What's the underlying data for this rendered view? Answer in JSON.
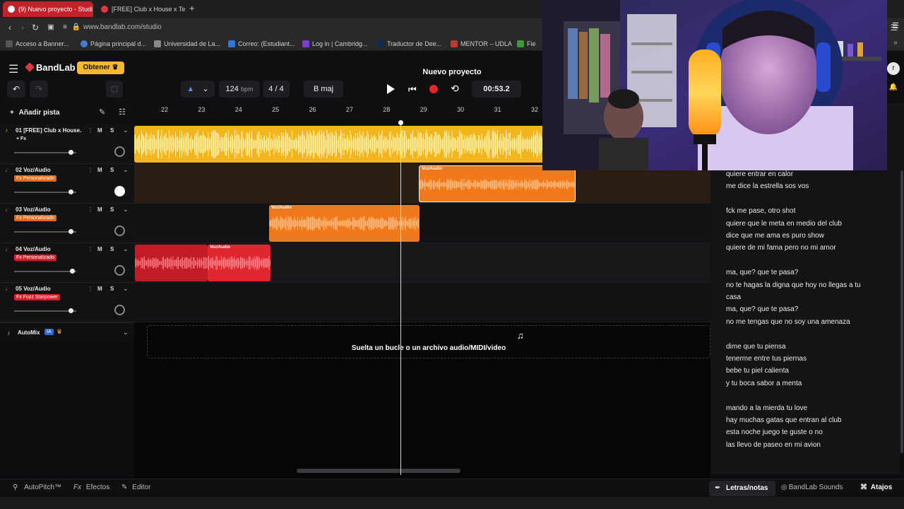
{
  "browser": {
    "tabs": [
      {
        "label": "(9) Nuevo proyecto - Studi",
        "active": true
      },
      {
        "label": "[FREE] Club x House x Te",
        "active": false
      }
    ],
    "new_tab": "+",
    "url": "www.bandlab.com/studio",
    "bookmarks": [
      {
        "label": "Acceso a Banner...",
        "color": "#555"
      },
      {
        "label": "Página principal d...",
        "color": "#4a7bd1"
      },
      {
        "label": "Universidad de La...",
        "color": "#8a8a8a"
      },
      {
        "label": "Correo: (Estudiant...",
        "color": "#2f7ad9"
      },
      {
        "label": "Log in | Cambridg...",
        "color": "#7c3bd1"
      },
      {
        "label": "Traductor de Dee...",
        "color": "#0d2c54"
      },
      {
        "label": "MENTOR – UDLA",
        "color": "#c0392b"
      },
      {
        "label": "Fie",
        "color": "#3a9a3a"
      }
    ]
  },
  "app": {
    "brand": "BandLab",
    "obtener": "Obtener",
    "project_title": "Nuevo proyecto",
    "bpm_value": "124",
    "bpm_unit": "bpm",
    "time_signature": "4 / 4",
    "key": "B maj",
    "timecode": "00:53.2",
    "add_track": "Añadir pista",
    "automix": "AutoMix",
    "automix_badge": "IA",
    "drop_zone": "Suelta un bucle o un archivo audio/MIDI/video"
  },
  "ruler": [
    "22",
    "23",
    "24",
    "25",
    "26",
    "27",
    "28",
    "29",
    "30",
    "31",
    "32"
  ],
  "tracks": [
    {
      "name": "01  [FREE] Club x House...",
      "fx": "+ Fx",
      "fx_style": "plain",
      "mute": "M",
      "solo": "S",
      "vol": 0.87
    },
    {
      "name": "02  Voz/Audio",
      "fx": "Fx Personalizado",
      "fx_style": "orange",
      "mute": "M",
      "solo": "S",
      "vol": 0.87
    },
    {
      "name": "03  Voz/Audio",
      "fx": "Fx Personalizado",
      "fx_style": "orange",
      "mute": "M",
      "solo": "S",
      "vol": 0.87
    },
    {
      "name": "04  Voz/Audio",
      "fx": "Fx Personalizado",
      "fx_style": "red",
      "mute": "M",
      "solo": "S",
      "vol": 0.9
    },
    {
      "name": "05  Voz/Audio",
      "fx": "Fx Fuzz Starpower",
      "fx_style": "red",
      "mute": "M",
      "solo": "S",
      "vol": 0.87
    }
  ],
  "clip_label": "Voz/Audio",
  "lyrics": [
    "quiere entrar en calor",
    "me dice la estrella sos vos",
    "",
    "fck me pase, otro shot",
    "quiere que le meta en medio del club",
    "dice que me ama es puro show",
    "quiere de mi fama pero no mi amor",
    "",
    "ma, que? que te pasa?",
    "no te hagas la digna que hoy no llegas a tu",
    "casa",
    "ma, que? que te pasa?",
    "no me tengas que no soy una amenaza",
    "",
    "dime que tu piensa",
    "tenerme entre tus piernas",
    "bebe tu piel calienta",
    "y tu boca sabor a menta",
    "",
    "mando a la mierda tu love",
    "hay muchas gatas que entran al club",
    "esta noche juego te guste o no",
    "las llevo de paseo en mi avion"
  ],
  "footer": {
    "autopitch": "AutoPitch™",
    "efectos": "Efectos",
    "editor": "Editor",
    "letras": "Letras/notas",
    "sounds": "BandLab Sounds",
    "atajos": "Atajos"
  },
  "colors": {
    "accent": "#f5b82e",
    "orange": "#f07a1a",
    "red": "#e0262e",
    "yellow": "#f2b51d"
  }
}
